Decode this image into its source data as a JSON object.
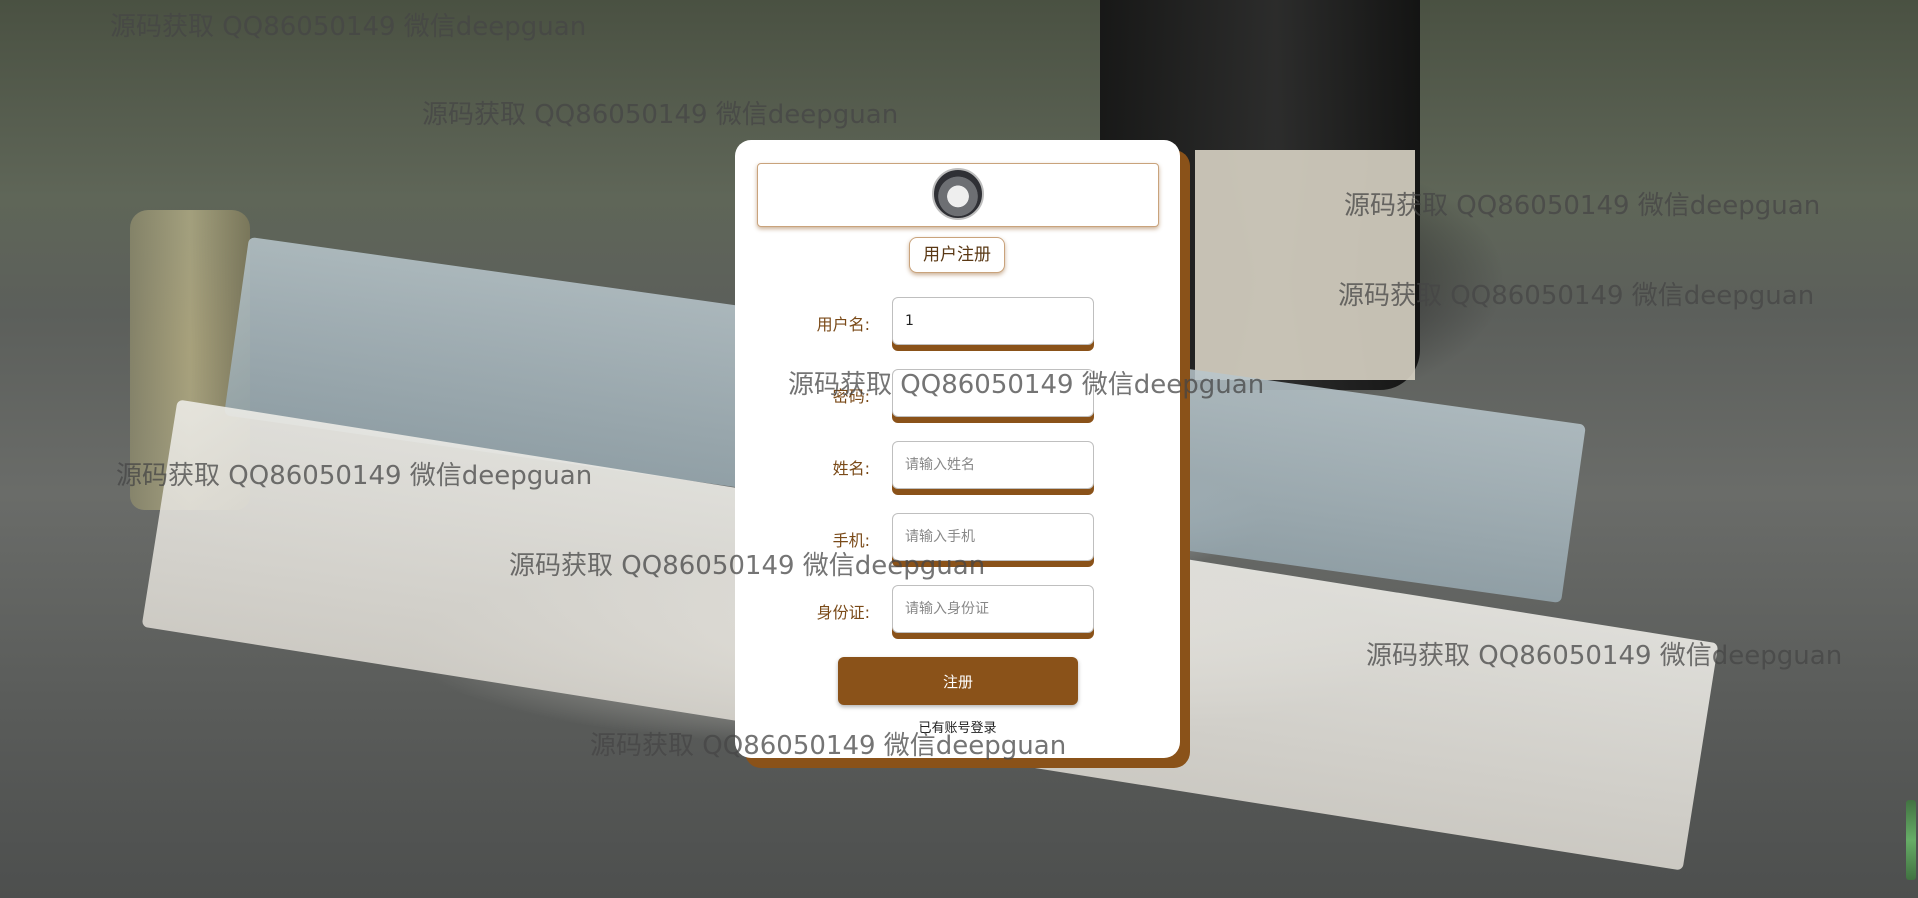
{
  "form": {
    "title": "用户注册",
    "fields": [
      {
        "label": "用户名:",
        "value": "1",
        "placeholder": ""
      },
      {
        "label": "密码:",
        "value": "",
        "placeholder": ""
      },
      {
        "label": "姓名:",
        "value": "",
        "placeholder": "请输入姓名"
      },
      {
        "label": "手机:",
        "value": "",
        "placeholder": "请输入手机"
      },
      {
        "label": "身份证:",
        "value": "",
        "placeholder": "请输入身份证"
      }
    ],
    "submit_label": "注册",
    "login_link": "已有账号登录"
  },
  "watermark": {
    "text": "源码获取 QQ86050149 微信deepguan"
  },
  "colors": {
    "accent": "#8a5219",
    "card_background": "#ffffff"
  },
  "icons": {
    "avatar": "husky-avatar"
  }
}
